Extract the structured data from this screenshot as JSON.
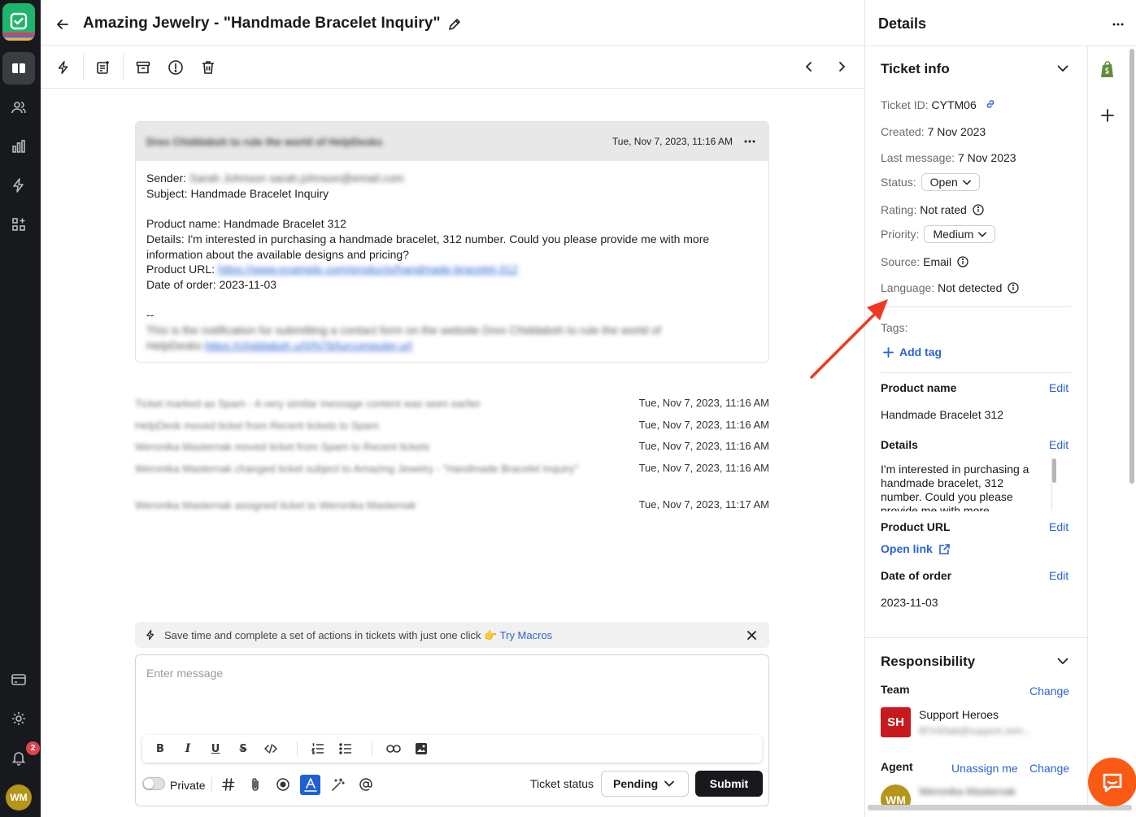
{
  "header": {
    "title": "Amazing Jewelry - \"Handmade Bracelet Inquiry\""
  },
  "user": {
    "initials": "WM",
    "notifications": "2"
  },
  "message": {
    "header_blurred": "Drex Chiddabsh to rule the world of HelpDesks",
    "time": "Tue, Nov 7, 2023, 11:16 AM",
    "sender_label": "Sender:",
    "sender_blurred": "Sarah Johnson sarah.johnson@email.com",
    "subject": "Subject: Handmade Bracelet Inquiry",
    "product_name": "Product name: Handmade Bracelet 312",
    "details": "Details: I'm interested in purchasing a handmade bracelet, 312 number. Could you please provide me with more information about the available designs and pricing?",
    "product_url_label": "Product URL:",
    "product_url_blurred": "https://www.example.com/products/handmade-bracelet-312",
    "date_of_order": "Date of order: 2023-11-03",
    "sig_dash": "--",
    "footer_blurred": "This is the notification for submitting a contact form on the website Drex Chiddabsh to rule the world of",
    "footer_blurred2": "HelpDesks",
    "footer_link_blurred": "https://chiddabsh.u/0/N76/lurcomputer.url"
  },
  "events": [
    {
      "text": "Ticket marked as Spam - A very similar message content was seen earlier",
      "time": "Tue, Nov 7, 2023, 11:16 AM"
    },
    {
      "text": "HelpDesk moved ticket from Recent tickets to Spam",
      "time": "Tue, Nov 7, 2023, 11:16 AM"
    },
    {
      "text": "Weronika Masternak moved ticket from Spam to Recent tickets",
      "time": "Tue, Nov 7, 2023, 11:16 AM"
    },
    {
      "text": "Weronika Masternak changed ticket subject to Amazing Jewelry - \"Handmade Bracelet Inquiry\"",
      "time": "Tue, Nov 7, 2023, 11:16 AM"
    },
    {
      "text": "Weronika Masternak assigned ticket to Weronika Masternak",
      "time": "Tue, Nov 7, 2023, 11:17 AM"
    }
  ],
  "macro_banner": {
    "text": "Save time and complete a set of actions in tickets with just one click 👉",
    "link": "Try Macros"
  },
  "composer": {
    "placeholder": "Enter message",
    "private_label": "Private",
    "ticket_status_label": "Ticket status",
    "status_value": "Pending",
    "submit_label": "Submit"
  },
  "details": {
    "title": "Details",
    "ticket_info": {
      "title": "Ticket info",
      "ticket_id_label": "Ticket ID:",
      "ticket_id": "CYTM06",
      "created_label": "Created:",
      "created": "7 Nov 2023",
      "last_message_label": "Last message:",
      "last_message": "7 Nov 2023",
      "status_label": "Status:",
      "status": "Open",
      "rating_label": "Rating:",
      "rating": "Not rated",
      "priority_label": "Priority:",
      "priority": "Medium",
      "source_label": "Source:",
      "source": "Email",
      "language_label": "Language:",
      "language": "Not detected",
      "tags_label": "Tags:",
      "add_tag": "Add tag"
    },
    "fields": {
      "edit_label": "Edit",
      "product_name_label": "Product name",
      "product_name": "Handmade Bracelet 312",
      "details_label": "Details",
      "details_text": "I'm interested in purchasing a handmade bracelet, 312 number. Could you please provide me with more",
      "product_url_label": "Product URL",
      "open_link": "Open link",
      "date_of_order_label": "Date of order",
      "date_of_order": "2023-11-03"
    },
    "responsibility": {
      "title": "Responsibility",
      "team_label": "Team",
      "change_label": "Change",
      "team_initials": "SH",
      "team_name": "Support Heroes",
      "team_email_blurred": "f87e93ab@support.zem...",
      "agent_label": "Agent",
      "unassign_label": "Unassign me",
      "agent_initials": "WM",
      "agent_name_blurred": "Weronika Masternak"
    }
  },
  "colors": {
    "brand_green": "#1fb46b",
    "link_blue": "#2a63d6",
    "annotation_arrow": "#ee3a24",
    "chat_orange": "#fb5a14"
  }
}
